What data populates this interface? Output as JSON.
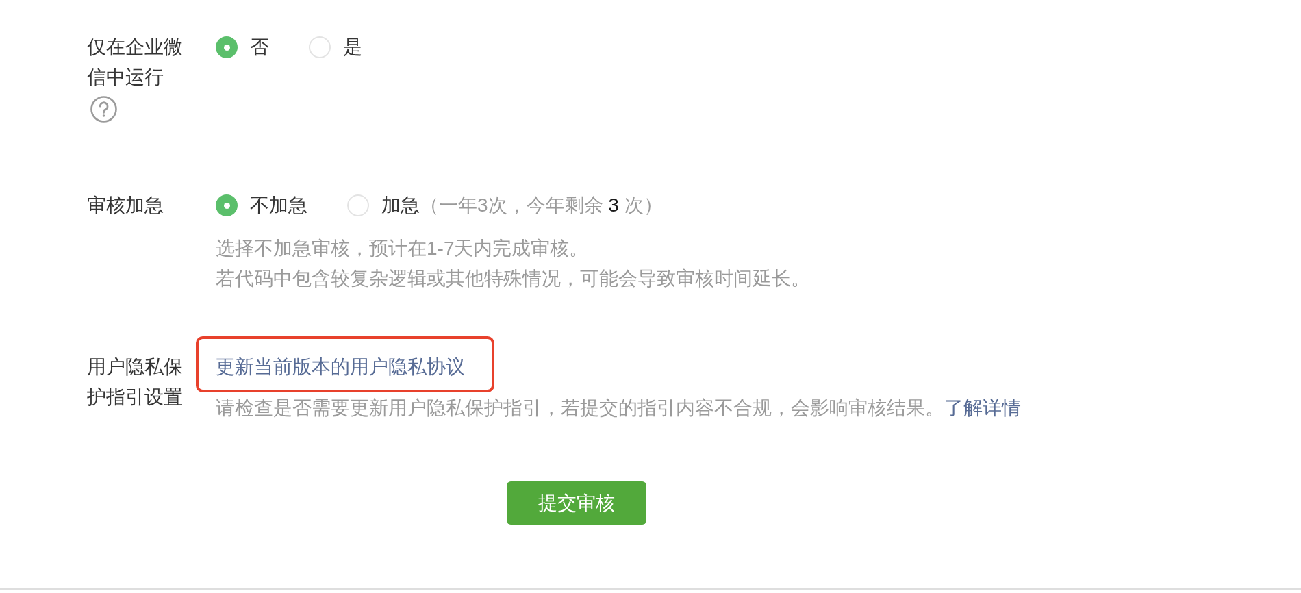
{
  "form": {
    "rows": [
      {
        "kind": "radio",
        "label": "仅在企业微信中运行",
        "help": true,
        "options": [
          {
            "label": "否",
            "selected": true
          },
          {
            "label": "是",
            "selected": false
          }
        ]
      },
      {
        "kind": "radio",
        "label": "审核加急",
        "options": [
          {
            "label": "不加急",
            "selected": true
          },
          {
            "label": "加急",
            "selected": false,
            "note": "（一年3次，今年剩余 **3** 次）"
          }
        ],
        "description": [
          {
            "text": "选择不加急审核，预计在1-7天内完成审核。"
          },
          {
            "text": "若代码中包含较复杂逻辑或其他特殊情况，可能会导致审核时间延长。"
          }
        ]
      },
      {
        "kind": "link",
        "label": "用户隐私保护指引设置",
        "link": {
          "text": "更新当前版本的用户隐私协议",
          "highlighted": true
        },
        "description": [
          {
            "text": "请检查是否需要更新用户隐私保护指引，若提交的指引内容不合规，会影响审核结果。",
            "link": "了解详情"
          }
        ]
      }
    ]
  },
  "submit_button": "提交审核"
}
